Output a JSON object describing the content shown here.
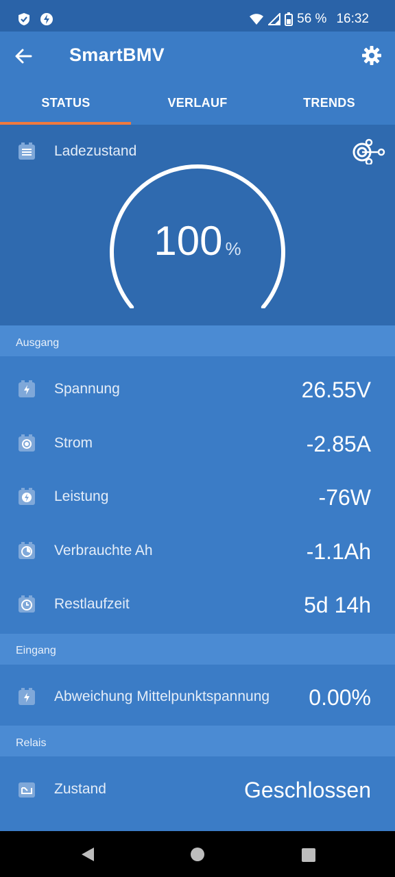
{
  "status_bar": {
    "battery": "56 %",
    "time": "16:32"
  },
  "app_bar": {
    "title": "SmartBMV"
  },
  "tabs": [
    {
      "label": "STATUS",
      "active": true
    },
    {
      "label": "VERLAUF",
      "active": false
    },
    {
      "label": "TRENDS",
      "active": false
    }
  ],
  "gauge": {
    "label": "Ladezustand",
    "value": "100",
    "unit": "%",
    "fraction": 1.0
  },
  "sections": {
    "output": {
      "header": "Ausgang",
      "rows": [
        {
          "label": "Spannung",
          "value": "26.55V",
          "icon": "battery-bolt-icon"
        },
        {
          "label": "Strom",
          "value": "-2.85A",
          "icon": "battery-target-icon"
        },
        {
          "label": "Leistung",
          "value": "-76W",
          "icon": "battery-power-icon"
        },
        {
          "label": "Verbrauchte Ah",
          "value": "-1.1Ah",
          "icon": "battery-consumption-icon"
        },
        {
          "label": "Restlaufzeit",
          "value": "5d 14h",
          "icon": "battery-clock-icon"
        }
      ]
    },
    "input": {
      "header": "Eingang",
      "rows": [
        {
          "label": "Abweichung Mittelpunktspannung",
          "value": "0.00%",
          "icon": "battery-bolt-icon"
        }
      ]
    },
    "relay": {
      "header": "Relais",
      "rows": [
        {
          "label": "Zustand",
          "value": "Geschlossen",
          "icon": "relay-icon"
        }
      ]
    }
  },
  "colors": {
    "accent": "#f0793d",
    "primary": "#3b7cc6",
    "dark": "#2f6aaf"
  }
}
